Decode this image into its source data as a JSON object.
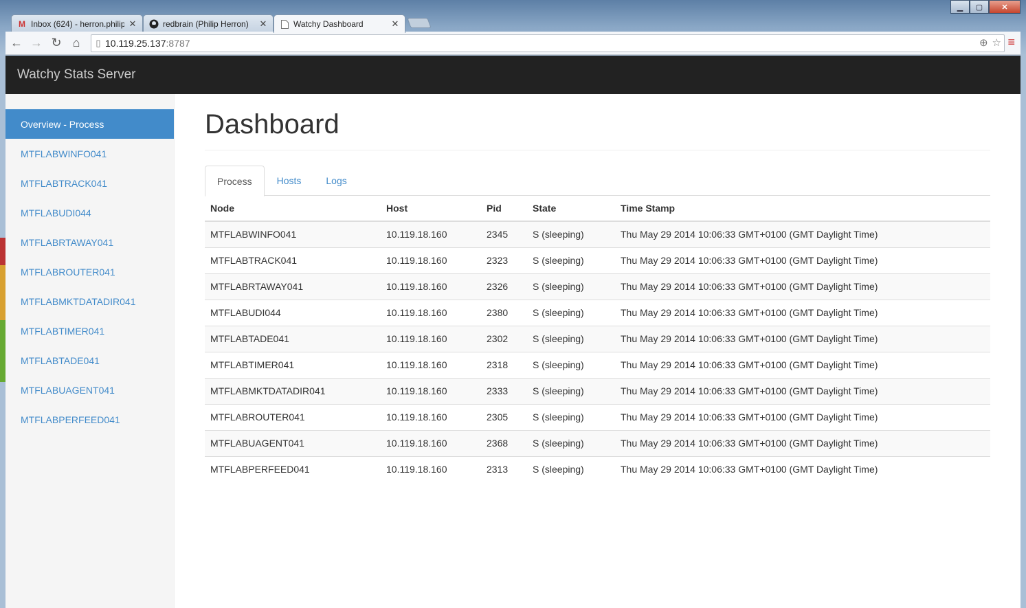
{
  "browser": {
    "tabs": [
      {
        "title": "Inbox (624) - herron.philip",
        "icon": "gmail-icon"
      },
      {
        "title": "redbrain (Philip Herron)",
        "icon": "github-icon"
      },
      {
        "title": "Watchy Dashboard",
        "icon": "page-icon"
      }
    ],
    "url_host": "10.119.25.137",
    "url_port": ":8787"
  },
  "app": {
    "brand": "Watchy Stats Server"
  },
  "sidebar": {
    "items": [
      {
        "label": "Overview - Process",
        "active": true
      },
      {
        "label": "MTFLABWINFO041"
      },
      {
        "label": "MTFLABTRACK041"
      },
      {
        "label": "MTFLABUDI044"
      },
      {
        "label": "MTFLABRTAWAY041"
      },
      {
        "label": "MTFLABROUTER041"
      },
      {
        "label": "MTFLABMKTDATADIR041"
      },
      {
        "label": "MTFLABTIMER041"
      },
      {
        "label": "MTFLABTADE041"
      },
      {
        "label": "MTFLABUAGENT041"
      },
      {
        "label": "MTFLABPERFEED041"
      }
    ]
  },
  "main": {
    "title": "Dashboard",
    "tabs": [
      "Process",
      "Hosts",
      "Logs"
    ],
    "table": {
      "headers": [
        "Node",
        "Host",
        "Pid",
        "State",
        "Time Stamp"
      ],
      "rows": [
        [
          "MTFLABWINFO041",
          "10.119.18.160",
          "2345",
          "S (sleeping)",
          "Thu May 29 2014 10:06:33 GMT+0100 (GMT Daylight Time)"
        ],
        [
          "MTFLABTRACK041",
          "10.119.18.160",
          "2323",
          "S (sleeping)",
          "Thu May 29 2014 10:06:33 GMT+0100 (GMT Daylight Time)"
        ],
        [
          "MTFLABRTAWAY041",
          "10.119.18.160",
          "2326",
          "S (sleeping)",
          "Thu May 29 2014 10:06:33 GMT+0100 (GMT Daylight Time)"
        ],
        [
          "MTFLABUDI044",
          "10.119.18.160",
          "2380",
          "S (sleeping)",
          "Thu May 29 2014 10:06:33 GMT+0100 (GMT Daylight Time)"
        ],
        [
          "MTFLABTADE041",
          "10.119.18.160",
          "2302",
          "S (sleeping)",
          "Thu May 29 2014 10:06:33 GMT+0100 (GMT Daylight Time)"
        ],
        [
          "MTFLABTIMER041",
          "10.119.18.160",
          "2318",
          "S (sleeping)",
          "Thu May 29 2014 10:06:33 GMT+0100 (GMT Daylight Time)"
        ],
        [
          "MTFLABMKTDATADIR041",
          "10.119.18.160",
          "2333",
          "S (sleeping)",
          "Thu May 29 2014 10:06:33 GMT+0100 (GMT Daylight Time)"
        ],
        [
          "MTFLABROUTER041",
          "10.119.18.160",
          "2305",
          "S (sleeping)",
          "Thu May 29 2014 10:06:33 GMT+0100 (GMT Daylight Time)"
        ],
        [
          "MTFLABUAGENT041",
          "10.119.18.160",
          "2368",
          "S (sleeping)",
          "Thu May 29 2014 10:06:33 GMT+0100 (GMT Daylight Time)"
        ],
        [
          "MTFLABPERFEED041",
          "10.119.18.160",
          "2313",
          "S (sleeping)",
          "Thu May 29 2014 10:06:33 GMT+0100 (GMT Daylight Time)"
        ]
      ]
    }
  },
  "colors": {
    "navbar_bg": "#222222",
    "accent": "#428bca",
    "sidebar_bg": "#f5f5f5"
  }
}
